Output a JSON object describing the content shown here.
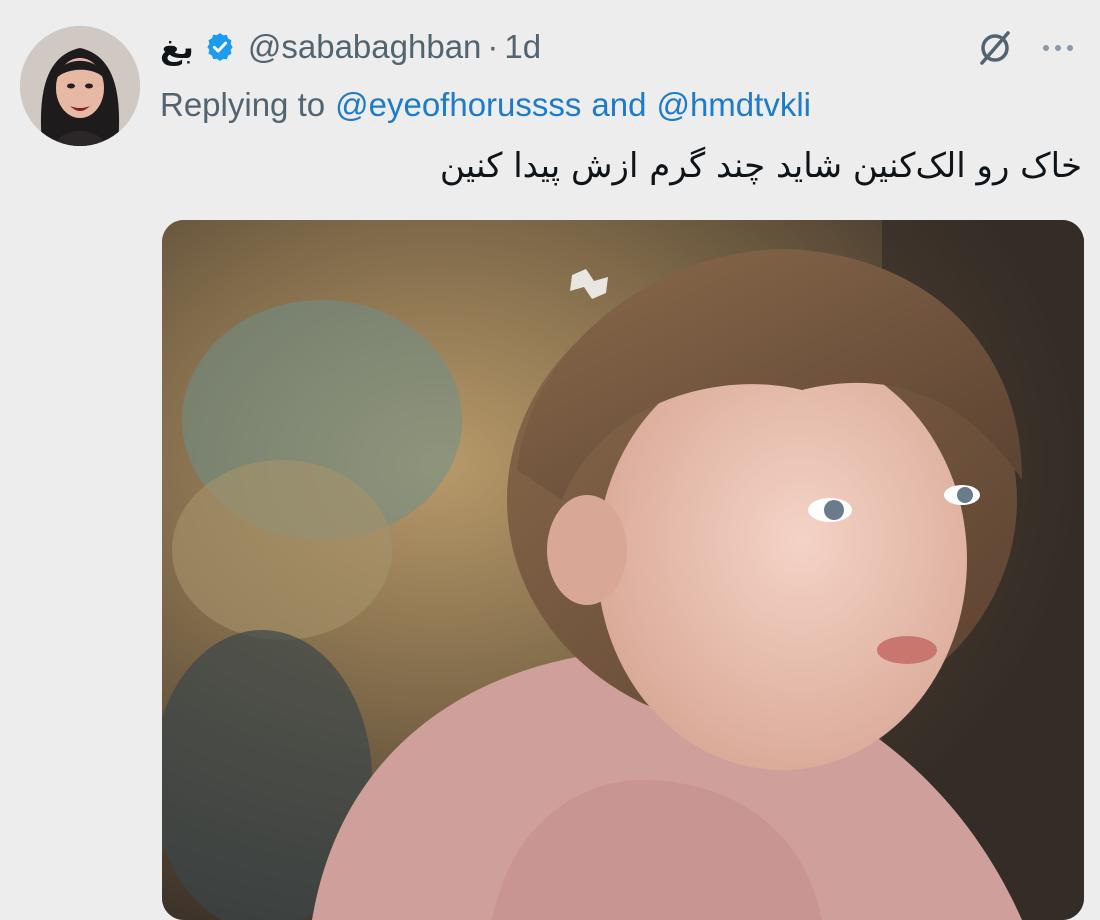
{
  "tweet": {
    "display_name": "بغ",
    "handle": "@sababaghban",
    "separator": "·",
    "time": "1d",
    "reply_prefix": "Replying to",
    "reply_mention_1": "@eyeofhorussss",
    "reply_conjunction": "and",
    "reply_mention_2": "@hmdtvkli",
    "text": "خاک رو الک‌کنین شاید چند گرم ازش پیدا کنین"
  },
  "icons": {
    "avatar": "avatar-portrait",
    "verified": "verified-badge-icon",
    "grok": "slashed-circle-icon",
    "more": "more-dots-icon"
  },
  "colors": {
    "background": "#ededed",
    "text_primary": "#0f1419",
    "text_secondary": "#536471",
    "link": "#1d7bc9",
    "verified": "#1d9bf0"
  }
}
